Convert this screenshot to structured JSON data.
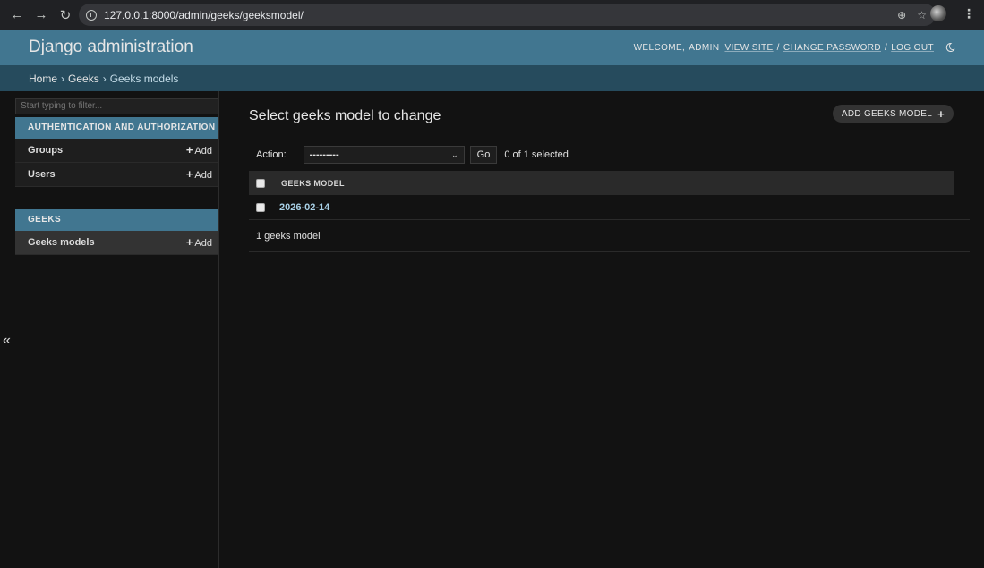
{
  "browser": {
    "url": "127.0.0.1:8000/admin/geeks/geeksmodel/"
  },
  "header": {
    "branding": "Django administration",
    "welcome": "WELCOME,",
    "username": "ADMIN",
    "view_site": "VIEW SITE",
    "change_password": "CHANGE PASSWORD",
    "log_out": "LOG OUT",
    "separator": "/"
  },
  "breadcrumbs": {
    "home": "Home",
    "app": "Geeks",
    "current": "Geeks models",
    "separator": "›"
  },
  "sidebar": {
    "filter_placeholder": "Start typing to filter...",
    "add_label": "Add",
    "modules": [
      {
        "caption": "AUTHENTICATION AND AUTHORIZATION",
        "models": [
          "Groups",
          "Users"
        ]
      },
      {
        "caption": "GEEKS",
        "models": [
          "Geeks models"
        ]
      }
    ],
    "collapse_symbol": "«"
  },
  "content": {
    "title": "Select geeks model to change",
    "add_button": "ADD GEEKS MODEL",
    "action_label": "Action:",
    "action_selected": "---------",
    "go_label": "Go",
    "selected_counter": "0 of 1 selected",
    "column_header": "GEEKS MODEL",
    "rows": [
      "2026-02-14"
    ],
    "paginator": "1 geeks model"
  },
  "colors": {
    "header_bg": "#417690",
    "breadcrumbs_bg": "#264b5d",
    "body_bg": "#121212",
    "link": "#a8d0e6"
  }
}
